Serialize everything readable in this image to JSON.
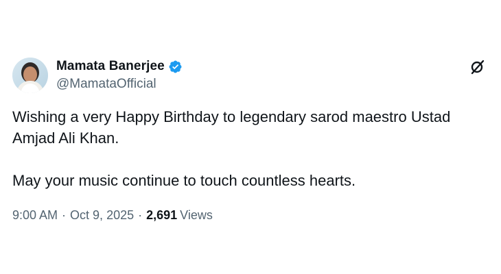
{
  "tweet": {
    "author": {
      "display_name": "Mamata Banerjee",
      "handle": "@MamataOfficial",
      "verified_color": "#1d9bf0",
      "avatar_icon": "profile-photo"
    },
    "body": "Wishing a very Happy Birthday to legendary sarod maestro Ustad\nAmjad Ali Khan.\n\nMay your music continue to touch countless hearts.",
    "time": "9:00 AM",
    "separator": "·",
    "date": "Oct 9, 2025",
    "views_count": "2,691",
    "views_label": "Views",
    "grok_icon": "grok-icon"
  }
}
